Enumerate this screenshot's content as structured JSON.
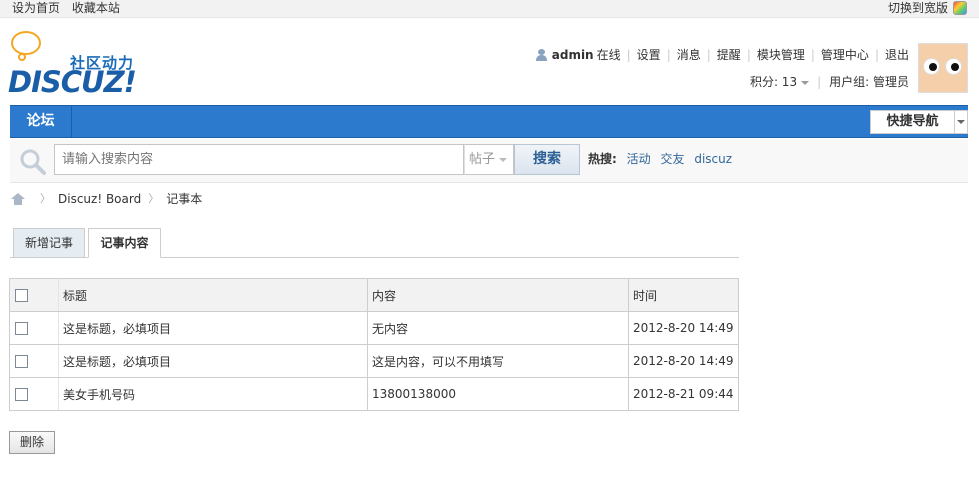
{
  "topbar": {
    "set_home": "设为首页",
    "bookmark": "收藏本站",
    "switch_width": "切换到宽版"
  },
  "header": {
    "logo_slogan": "社区动力",
    "logo_brand": "DISCUZ!",
    "username": "admin",
    "online_status": "在线",
    "links": [
      "设置",
      "消息",
      "提醒",
      "模块管理",
      "管理中心",
      "退出"
    ],
    "credits_label": "积分: 13",
    "user_group": "用户组: 管理员"
  },
  "nav": {
    "forum": "论坛",
    "quick_nav": "快捷导航"
  },
  "search": {
    "placeholder": "请输入搜索内容",
    "type": "帖子",
    "button": "搜索",
    "hot_label": "热搜:",
    "hot_links": [
      "活动",
      "交友",
      "discuz"
    ]
  },
  "breadcrumb": {
    "board": "Discuz! Board",
    "current": "记事本"
  },
  "tabs": {
    "new_note": "新增记事",
    "note_content": "记事内容"
  },
  "table": {
    "headers": {
      "title": "标题",
      "content": "内容",
      "time": "时间"
    },
    "rows": [
      {
        "title": "这是标题，必填项目",
        "content": "无内容",
        "time": "2012-8-20 14:49"
      },
      {
        "title": "这是标题，必填项目",
        "content": "这是内容，可以不用填写",
        "time": "2012-8-20 14:49"
      },
      {
        "title": "美女手机号码",
        "content": "13800138000",
        "time": "2012-8-21 09:44"
      }
    ]
  },
  "actions": {
    "delete": "删除"
  }
}
